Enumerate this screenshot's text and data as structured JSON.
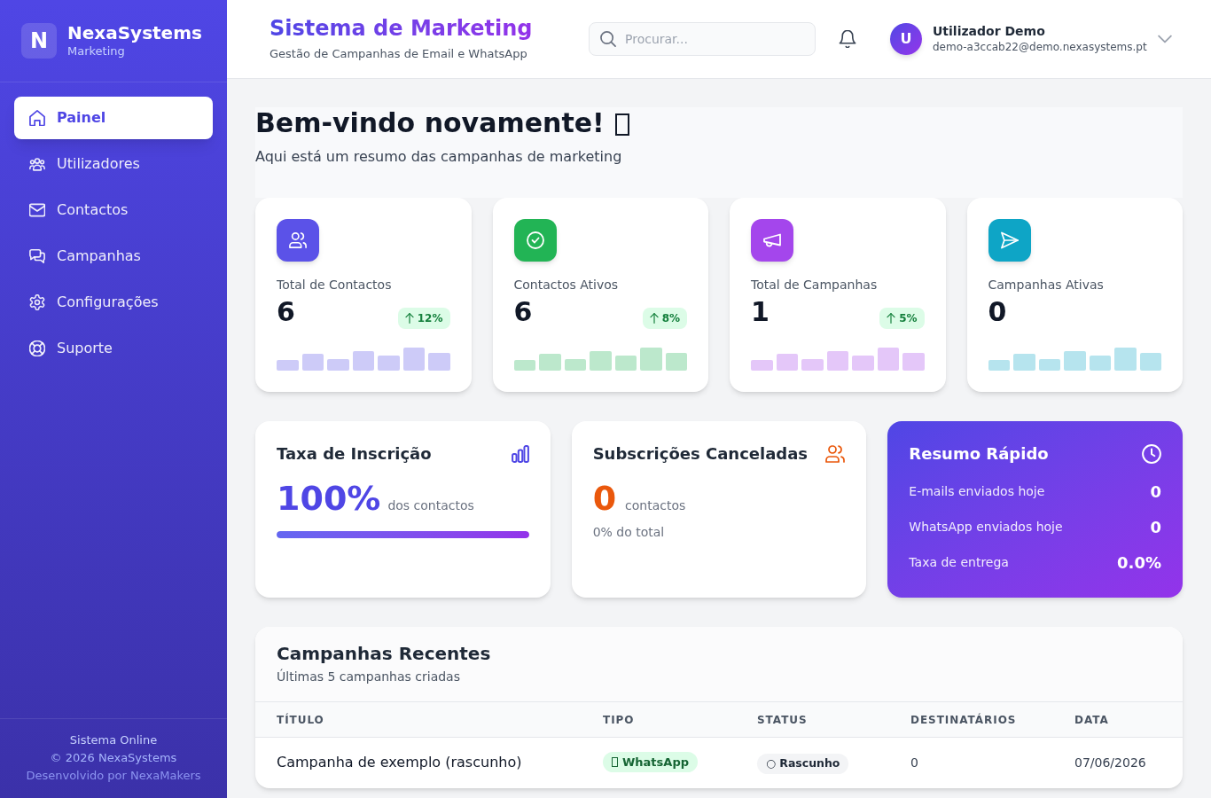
{
  "sidebar": {
    "logo_letter": "N",
    "brand": "NexaSystems",
    "subtitle": "Marketing",
    "items": [
      {
        "label": "Painel",
        "selected": true
      },
      {
        "label": "Utilizadores",
        "selected": false
      },
      {
        "label": "Contactos",
        "selected": false
      },
      {
        "label": "Campanhas",
        "selected": false
      },
      {
        "label": "Configurações",
        "selected": false
      },
      {
        "label": "Suporte",
        "selected": false
      }
    ],
    "footer": [
      "Sistema Online",
      "© 2026 NexaSystems",
      "Desenvolvido por NexaMakers"
    ]
  },
  "header": {
    "title": "Sistema de Marketing",
    "subtitle": "Gestão de Campanhas de Email e WhatsApp",
    "search": {
      "placeholder": "Procurar..."
    },
    "user": {
      "avatar_letter": "U",
      "name": "Utilizador Demo",
      "email": "demo-a3ccab22@demo.nexasystems.pt"
    }
  },
  "welcome": {
    "title": "Bem-vindo novamente!",
    "subtitle": "Aqui está um resumo das campanhas de marketing"
  },
  "stats": [
    {
      "label": "Total de Contactos",
      "value": "6",
      "trend": "12%",
      "color": "#5b52e8"
    },
    {
      "label": "Contactos Ativos",
      "value": "6",
      "trend": "8%",
      "color": "#22b455"
    },
    {
      "label": "Total de Campanhas",
      "value": "1",
      "trend": "5%",
      "color": "#a446ec"
    },
    {
      "label": "Campanhas Ativas",
      "value": "0",
      "color": "#0ea5c6"
    }
  ],
  "subscription_rate": {
    "title": "Taxa de Inscrição",
    "value": "100%",
    "caption": "dos contactos",
    "level": 1
  },
  "cancelled": {
    "title": "Subscrições Canceladas",
    "value": "0",
    "caption": "contactos",
    "note": "0% do total"
  },
  "summary": {
    "title": "Resumo Rápido",
    "rows": [
      {
        "label": "E-mails enviados hoje",
        "value": "0"
      },
      {
        "label": "WhatsApp enviados hoje",
        "value": "0"
      },
      {
        "label": "Taxa de entrega",
        "value": "0.0%"
      }
    ]
  },
  "recent": {
    "title": "Campanhas Recentes",
    "subtitle": "Últimas 5 campanhas criadas",
    "columns": [
      "TÍTULO",
      "TIPO",
      "STATUS",
      "DESTINATÁRIOS",
      "DATA"
    ],
    "rows": [
      {
        "title": "Campanha de exemplo (rascunho)",
        "type": "WhatsApp",
        "status": "○ Rascunho",
        "recipients": "0",
        "date": "07/06/2026"
      }
    ]
  }
}
